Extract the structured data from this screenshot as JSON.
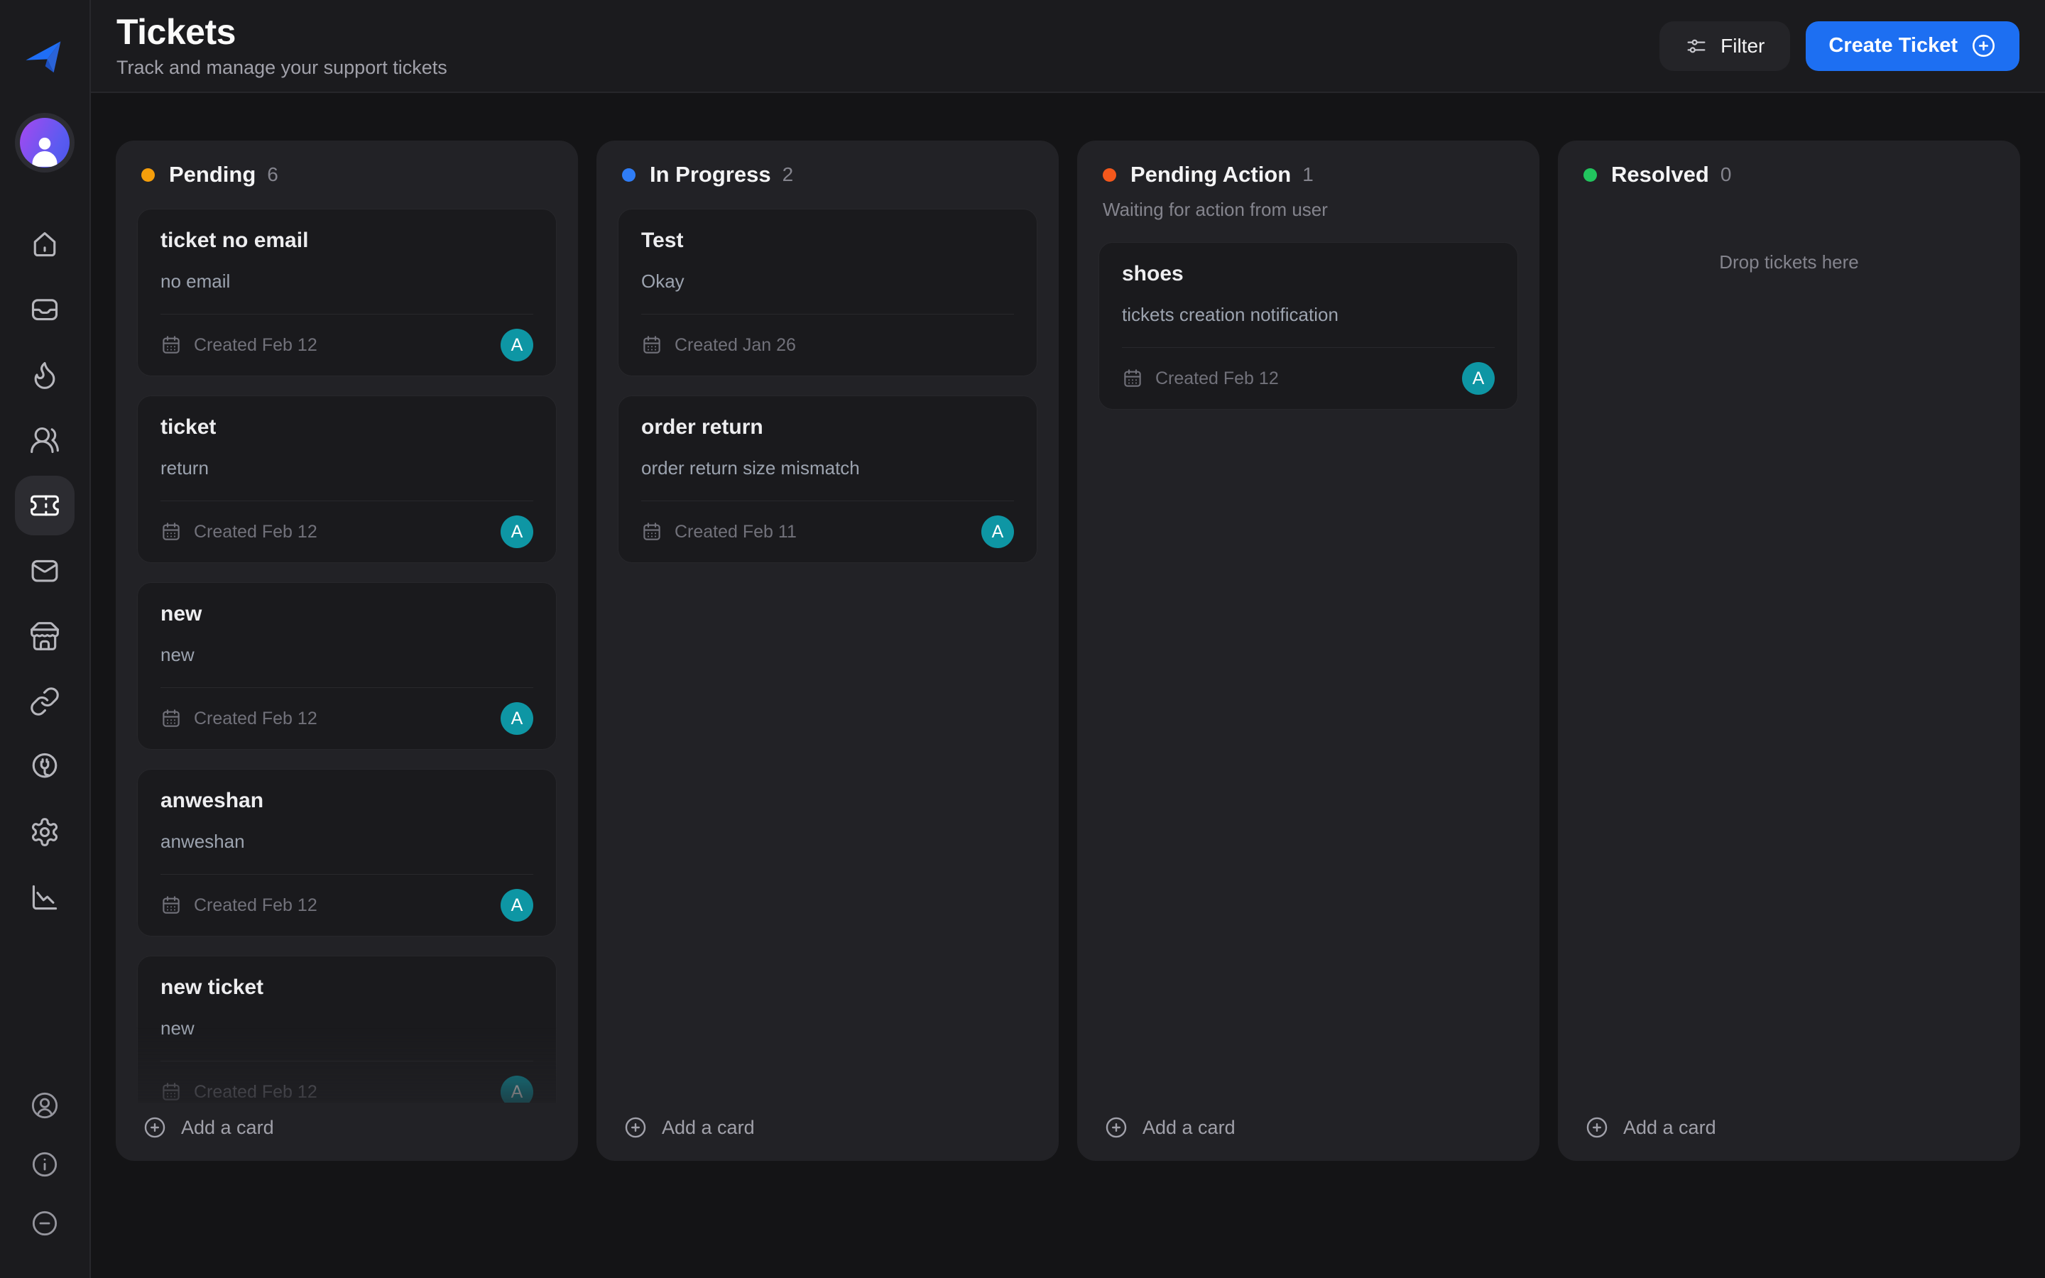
{
  "header": {
    "title": "Tickets",
    "subtitle": "Track and manage your support tickets",
    "filter_label": "Filter",
    "create_label": "Create Ticket"
  },
  "theme": {
    "accent_blue": "#1d6ff2",
    "avatar_color": "#0e96a4"
  },
  "board": {
    "add_card_label": "Add a card",
    "columns": [
      {
        "title": "Pending",
        "count": "6",
        "dot_color": "#f59e0b",
        "cards": [
          {
            "title": "ticket no email",
            "description": "no email",
            "created": "Created Feb 12",
            "avatar": "A"
          },
          {
            "title": "ticket",
            "description": "return",
            "created": "Created Feb 12",
            "avatar": "A"
          },
          {
            "title": "new",
            "description": "new",
            "created": "Created Feb 12",
            "avatar": "A"
          },
          {
            "title": "anweshan",
            "description": "anweshan",
            "created": "Created Feb 12",
            "avatar": "A"
          },
          {
            "title": "new ticket",
            "description": "new",
            "created": "Created Feb 12",
            "avatar": "A",
            "faded": true
          }
        ]
      },
      {
        "title": "In Progress",
        "count": "2",
        "dot_color": "#2f7df6",
        "cards": [
          {
            "title": "Test",
            "description": "Okay",
            "created": "Created Jan 26",
            "avatar": null
          },
          {
            "title": "order return",
            "description": "order return size mismatch",
            "created": "Created Feb 11",
            "avatar": "A"
          }
        ]
      },
      {
        "title": "Pending Action",
        "count": "1",
        "dot_color": "#f4581c",
        "subtitle": "Waiting for action from user",
        "cards": [
          {
            "title": "shoes",
            "description": "tickets creation notification",
            "created": "Created Feb 12",
            "avatar": "A"
          }
        ]
      },
      {
        "title": "Resolved",
        "count": "0",
        "dot_color": "#22c55e",
        "empty_text": "Drop tickets here",
        "cards": []
      }
    ]
  }
}
